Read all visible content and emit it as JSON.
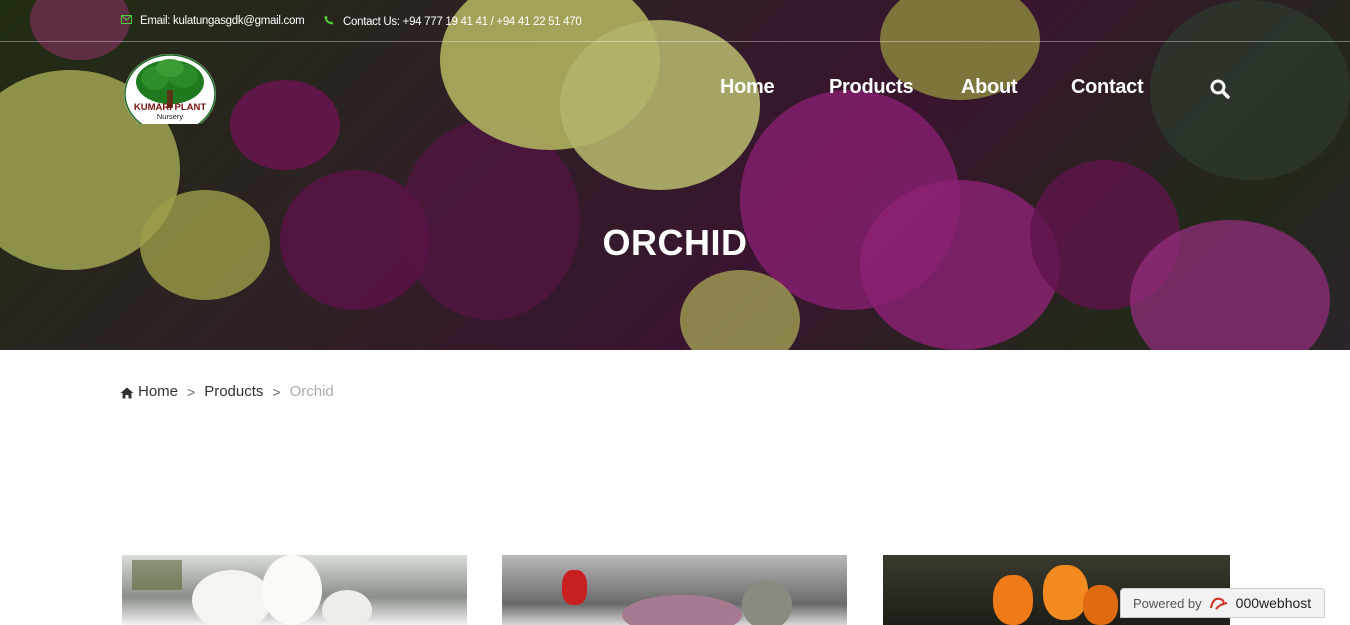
{
  "topbar": {
    "email": "Email: kulatungasgdk@gmail.com",
    "contact": "Contact Us: +94 777 19 41 41 / +94 41 22 51 470"
  },
  "logo": {
    "line1": "KUMARI PLANT",
    "line2": "Nursery"
  },
  "nav": {
    "items": [
      {
        "label": "Home"
      },
      {
        "label": "Products"
      },
      {
        "label": "About"
      },
      {
        "label": "Contact"
      }
    ]
  },
  "hero": {
    "title": "ORCHID"
  },
  "breadcrumb": {
    "home": "Home",
    "sep": ">",
    "products": "Products",
    "current": "Orchid"
  },
  "badge": {
    "powered": "Powered by",
    "brand": "000webhost"
  },
  "colors": {
    "accent_green": "#4cd137",
    "orchid_magenta": "#a0208a",
    "orchid_yellow": "#dede6a"
  }
}
